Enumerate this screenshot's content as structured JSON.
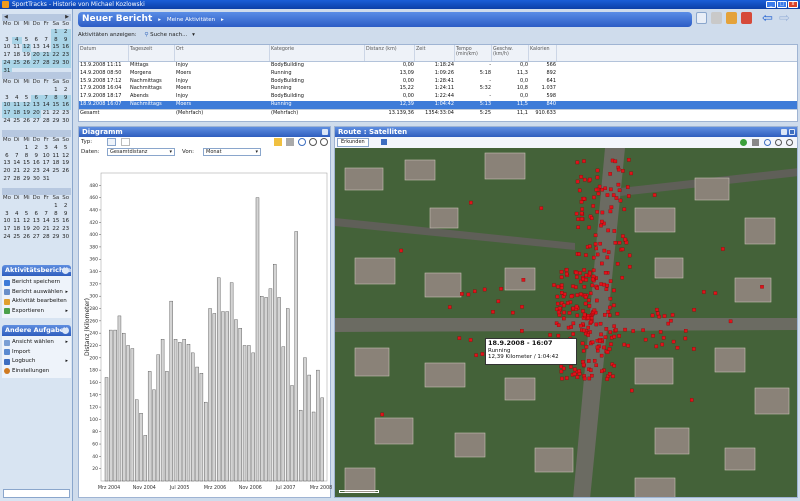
{
  "window": {
    "title": "SportTracks - Historie von Michael Kozlowski",
    "buttons": [
      "_",
      "□",
      "x"
    ]
  },
  "calendar": {
    "day_headers": [
      "Mo",
      "Di",
      "Mi",
      "Do",
      "Fr",
      "Sa",
      "So"
    ],
    "months": [
      {
        "days": [
          "",
          "",
          "",
          "",
          "",
          "1",
          "2",
          "3",
          "4",
          "5",
          "6",
          "7",
          "8",
          "9",
          "10",
          "11",
          "12",
          "13",
          "14",
          "15",
          "16",
          "17",
          "18",
          "19",
          "20",
          "21",
          "22",
          "23",
          "24",
          "25",
          "26",
          "27",
          "28",
          "29",
          "30",
          "31"
        ]
      },
      {
        "days": [
          "",
          "",
          "",
          "",
          "",
          "1",
          "2",
          "3",
          "4",
          "5",
          "6",
          "7",
          "8",
          "9",
          "10",
          "11",
          "12",
          "13",
          "14",
          "15",
          "16",
          "17",
          "18",
          "19",
          "20",
          "21",
          "22",
          "23",
          "24",
          "25",
          "26",
          "27",
          "28",
          "29",
          "30"
        ]
      },
      {
        "days": [
          "",
          "",
          "1",
          "2",
          "3",
          "4",
          "5",
          "6",
          "7",
          "8",
          "9",
          "10",
          "11",
          "12",
          "13",
          "14",
          "15",
          "16",
          "17",
          "18",
          "19",
          "20",
          "21",
          "22",
          "23",
          "24",
          "25",
          "26",
          "27",
          "28",
          "29",
          "30",
          "31"
        ]
      },
      {
        "days": [
          "",
          "",
          "",
          "",
          "",
          "1",
          "2",
          "3",
          "4",
          "5",
          "6",
          "7",
          "8",
          "9",
          "10",
          "11",
          "12",
          "13",
          "14",
          "15",
          "16",
          "17",
          "18",
          "19",
          "20",
          "21",
          "22",
          "23",
          "24",
          "25",
          "26",
          "27",
          "28",
          "29",
          "30"
        ]
      }
    ]
  },
  "activities": {
    "title": "Aktivitätsberichte",
    "items": [
      "Bericht speichern",
      "Bericht auswählen",
      "Aktivität bearbeiten",
      "Exportieren"
    ]
  },
  "tasks": {
    "title": "Andere Aufgaben",
    "items": [
      "Ansicht wählen",
      "Import",
      "Logbuch",
      "Einstellungen"
    ]
  },
  "header": {
    "title": "Neuer Bericht",
    "sub": "Meine Aktivitäten"
  },
  "toolbar": {
    "show": "Aktivitäten anzeigen:",
    "search": "Suche nach..."
  },
  "table": {
    "columns": [
      "Datum",
      "Tageszeit",
      "Ort",
      "Kategorie",
      "Distanz (km)",
      "Zeit",
      "Tempo (min/km)",
      "Geschw. (km/h)",
      "Kalorien"
    ],
    "rows": [
      [
        "13.9.2008 11:11",
        "Mittags",
        "Injoy",
        "BodyBuilding",
        "0,00",
        "1:18:24",
        "-",
        "0,0",
        "566"
      ],
      [
        "14.9.2008 08:50",
        "Morgens",
        "Moers",
        "Running",
        "13,09",
        "1:09:26",
        "5:18",
        "11,3",
        "892"
      ],
      [
        "15.9.2008 17:12",
        "Nachmittags",
        "Injoy",
        "BodyBuilding",
        "0,00",
        "1:28:41",
        "-",
        "0,0",
        "641"
      ],
      [
        "17.9.2008 16:04",
        "Nachmittags",
        "Moers",
        "Running",
        "15,22",
        "1:24:11",
        "5:32",
        "10,8",
        "1.037"
      ],
      [
        "17.9.2008 18:17",
        "Abends",
        "Injoy",
        "BodyBuilding",
        "0,00",
        "1:22:44",
        "-",
        "0,0",
        "598"
      ],
      [
        "18.9.2008 16:07",
        "Nachmittags",
        "Moers",
        "Running",
        "12,39",
        "1:04:42",
        "5:13",
        "11,5",
        "840"
      ]
    ],
    "total": [
      "Gesamt",
      "",
      "(Mehrfach)",
      "(Mehrfach)",
      "13.139,36",
      "1354:33:04",
      "5:25",
      "11,1",
      "910.633"
    ]
  },
  "diagram": {
    "title": "Diagramm",
    "typ_label": "Typ:",
    "daten_label": "Daten:",
    "daten_value": "Gesamtdistanz",
    "von_label": "Von:",
    "von_value": "Monat"
  },
  "chart_data": {
    "type": "bar",
    "ylabel": "Distanz (Kilometer)",
    "ylim": [
      0,
      500
    ],
    "yticks": [
      20,
      40,
      60,
      80,
      100,
      120,
      140,
      160,
      180,
      200,
      220,
      240,
      260,
      280,
      300,
      320,
      340,
      360,
      380,
      400,
      420,
      440,
      460,
      480
    ],
    "xtick_labels": [
      "Mrz 2004",
      "Nov 2004",
      "Jul 2005",
      "Mrz 2006",
      "Nov 2006",
      "Jul 2007",
      "Mrz 2008"
    ],
    "values": [
      168,
      245,
      245,
      268,
      240,
      220,
      215,
      132,
      110,
      74,
      178,
      148,
      205,
      230,
      178,
      292,
      230,
      225,
      230,
      222,
      208,
      185,
      175,
      128,
      280,
      272,
      330,
      275,
      275,
      322,
      262,
      248,
      220,
      220,
      208,
      460,
      300,
      298,
      312,
      352,
      298,
      218,
      280,
      155,
      405,
      115,
      200,
      172,
      112,
      180,
      135
    ]
  },
  "map": {
    "title": "Route : Satelliten",
    "tab": "Erkunden",
    "tooltip_title": "18.9.2008 - 16:07",
    "tooltip_line1": "Running",
    "tooltip_line2": "12,39 Kilometer / 1:04:42"
  }
}
